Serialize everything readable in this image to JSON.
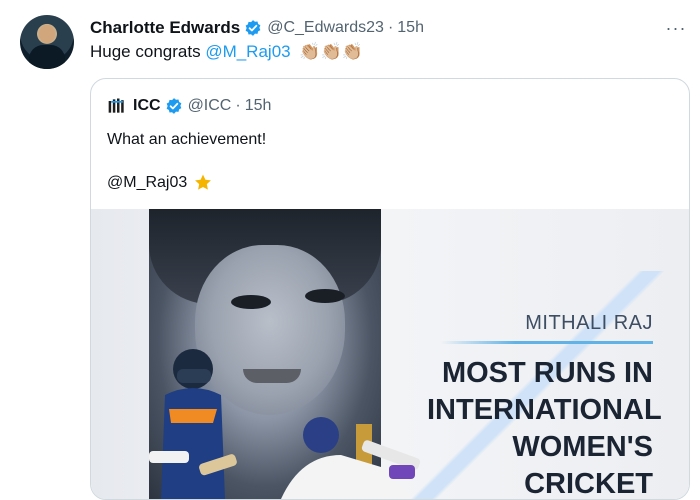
{
  "tweet": {
    "author_name": "Charlotte Edwards",
    "handle": "@C_Edwards23",
    "separator": "·",
    "time": "15h",
    "text_prefix": "Huge congrats",
    "mention": "@M_Raj03",
    "emoji": "👏🏼👏🏼👏🏼",
    "more": "···"
  },
  "quoted": {
    "author_name": "ICC",
    "handle": "@ICC",
    "separator": "·",
    "time": "15h",
    "line1": "What an achievement!",
    "line2": "@M_Raj03"
  },
  "media": {
    "name": "MITHALI RAJ",
    "headline": [
      "MOST RUNS IN",
      "INTERNATIONAL",
      "WOMEN'S",
      "CRICKET"
    ]
  },
  "colors": {
    "link": "#1d9bf0",
    "muted": "#536471",
    "verified": "#1d9bf0"
  },
  "icons": {
    "verified": "verified-badge-icon",
    "more": "more-icon",
    "icc_logo": "icc-logo-icon",
    "star": "star-icon"
  }
}
